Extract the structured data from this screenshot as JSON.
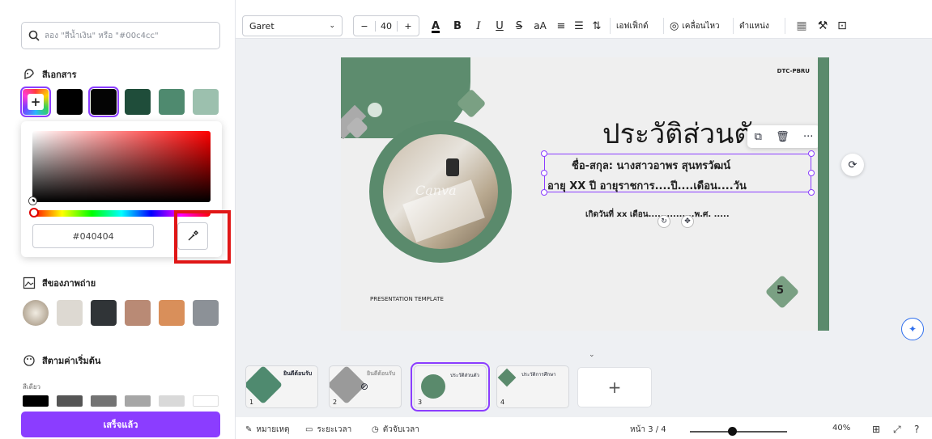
{
  "left_panel": {
    "search_placeholder": "ลอง \"สีน้ำเงิน\" หรือ \"#00c4cc\"",
    "document_colors_title": "สีเอกสาร",
    "document_swatches": [
      "#000000",
      "#040404",
      "#1f4d3a",
      "#4f8a6f",
      "#9cc0ae"
    ],
    "picker": {
      "hex_value": "#040404",
      "eyedropper_label": "eyedropper-icon"
    },
    "photo_colors_title": "สีของภาพถ่าย",
    "photo_swatches": [
      "#ddd9d2",
      "#303437",
      "#b98a75",
      "#d98f5a",
      "#8c9197"
    ],
    "default_colors_title": "สีตามค่าเริ่มต้น",
    "solid_label": "สีเดียว",
    "default_swatches": [
      "#000000",
      "#555555",
      "#737373",
      "#a6a6a6",
      "#d9d9d9",
      "#ffffff"
    ],
    "done_label": "เสร็จแล้ว"
  },
  "toolbar": {
    "font_name": "Garet",
    "font_size": "40",
    "minus": "−",
    "plus": "+",
    "effects_label": "เอฟเฟ็กต์",
    "animate_label": "เคลื่อนไหว",
    "position_label": "ตำแหน่ง"
  },
  "slide": {
    "brand": "DTC-PBRU",
    "title": "ประวัติส่วนตัว",
    "line1": "ชื่อ-สกุล: นางสาวอาพร สุนทรวัฒน์",
    "line2": "อายุ  XX  ปี อายุราชการ....ปี....เดือน....วัน",
    "line3": "เกิดวันที่ xx เดือน...............พ.ศ. .....",
    "number": "5",
    "presentation_template": "PRESENTATION TEMPLATE",
    "watermark": "Canva"
  },
  "filmstrip": {
    "thumbs": [
      {
        "num": "1",
        "title": "ยินดีต้อนรับ"
      },
      {
        "num": "2",
        "title": "ยินดีต้อนรับ"
      },
      {
        "num": "3",
        "title": "ประวัติส่วนตัว"
      },
      {
        "num": "4",
        "title": "ประวัติการศึกษา"
      }
    ],
    "add_label": "+"
  },
  "status": {
    "notes_label": "หมายเหตุ",
    "duration_label": "ระยะเวลา",
    "timer_label": "ตัวจับเวลา",
    "page_indicator": "หน้า 3 / 4",
    "zoom": "40%"
  },
  "colors": {
    "accent": "#8b3dff",
    "slide_green": "#5a8a6c",
    "highlight_red": "#e01616"
  }
}
